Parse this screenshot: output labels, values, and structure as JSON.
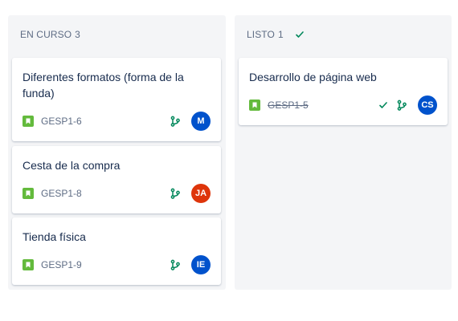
{
  "columns": [
    {
      "title": "EN CURSO",
      "count": "3",
      "cards": [
        {
          "title": "Diferentes formatos (forma de la funda)",
          "key": "GESP1-6",
          "avatar": "M",
          "avatar_color": "#0052cc"
        },
        {
          "title": "Cesta de la compra",
          "key": "GESP1-8",
          "avatar": "JA",
          "avatar_color": "#de350b"
        },
        {
          "title": "Tienda física",
          "key": "GESP1-9",
          "avatar": "IE",
          "avatar_color": "#0052cc"
        }
      ]
    },
    {
      "title": "LISTO",
      "count": "1",
      "header_icon": "check-icon",
      "cards": [
        {
          "title": "Desarrollo de página web",
          "key": "GESP1-5",
          "done": true,
          "avatar": "CS",
          "avatar_color": "#0052cc"
        }
      ]
    }
  ],
  "colors": {
    "story": "#63ba3c",
    "branch": "#00875a",
    "check": "#00875a",
    "column_bg": "#f4f5f7"
  },
  "icons": {
    "issue_type": "story-icon",
    "development": "branch-icon",
    "done": "check-icon"
  }
}
